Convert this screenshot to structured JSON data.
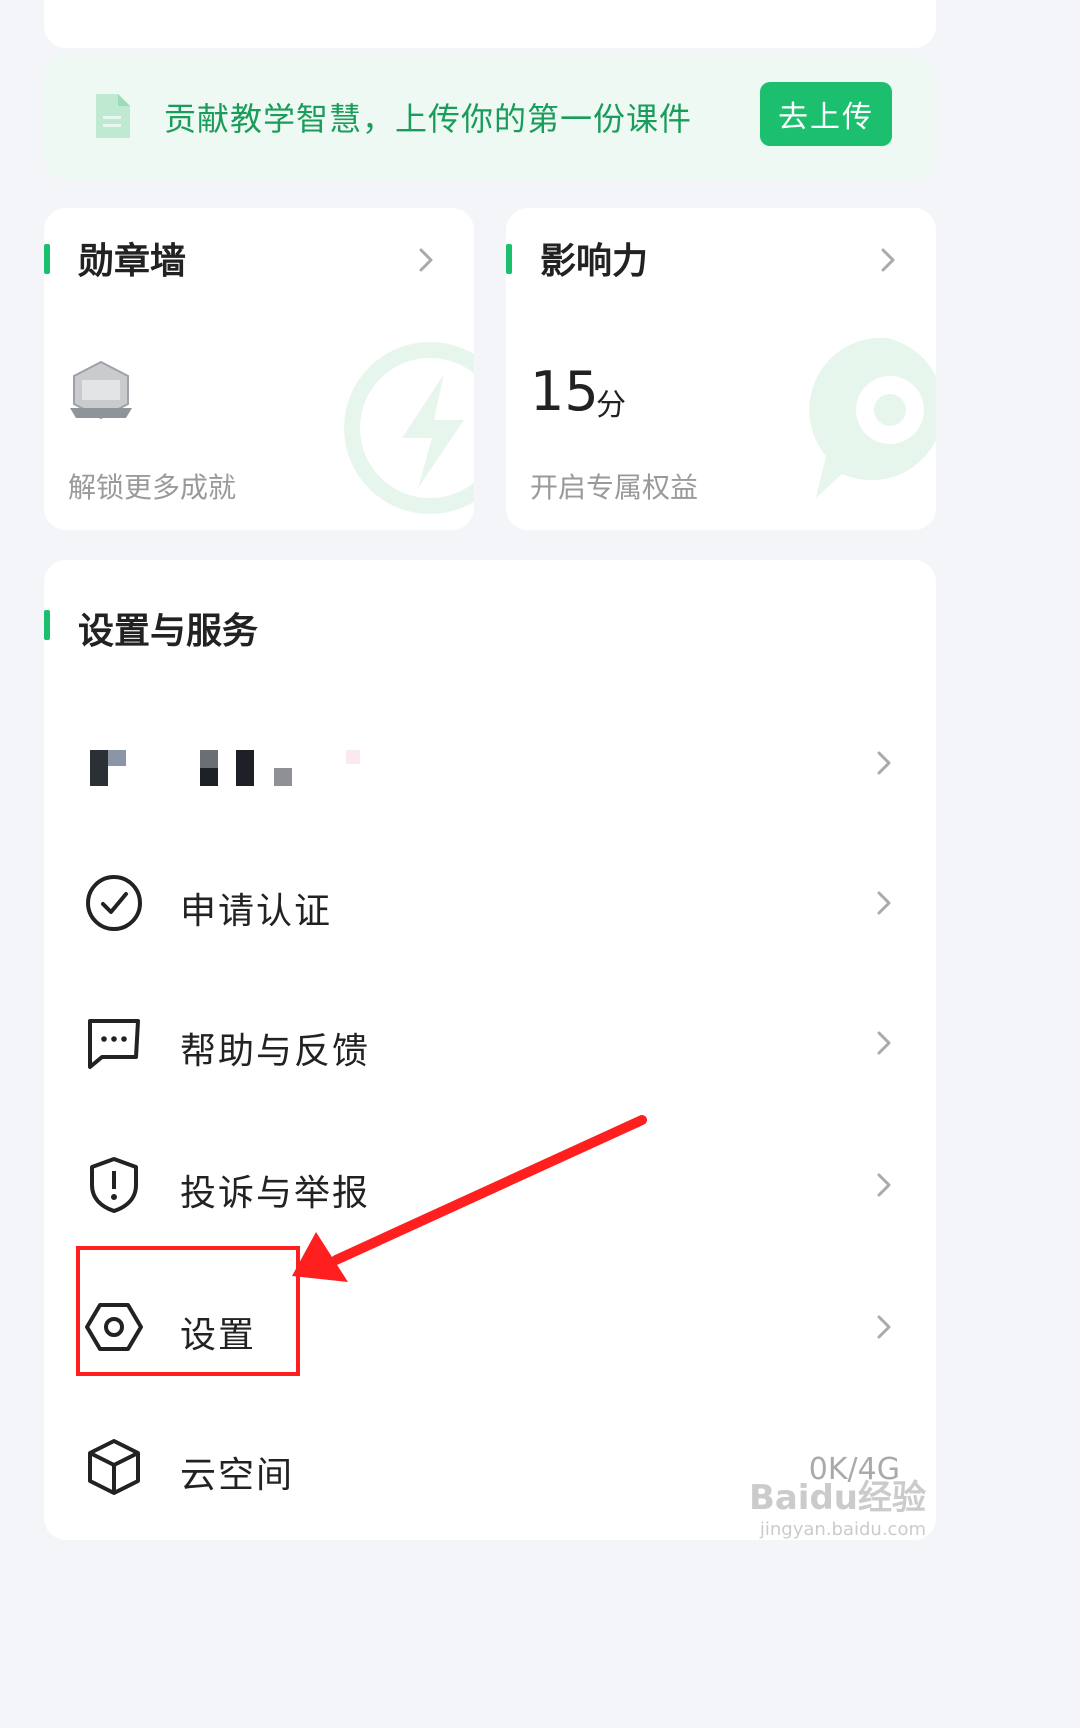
{
  "upload_banner": {
    "text": "贡献教学智慧，上传你的第一份课件",
    "button_label": "去上传"
  },
  "badge_card": {
    "title": "勋章墙",
    "subtitle": "解锁更多成就"
  },
  "influence_card": {
    "title": "影响力",
    "value": "15",
    "unit": "分",
    "subtitle": "开启专属权益"
  },
  "services": {
    "title": "设置与服务",
    "items": [
      {
        "label": "",
        "icon": "pixelated-redacted-icon",
        "extra": ""
      },
      {
        "label": "申请认证",
        "icon": "check-circle-icon",
        "extra": ""
      },
      {
        "label": "帮助与反馈",
        "icon": "chat-bubble-icon",
        "extra": ""
      },
      {
        "label": "投诉与举报",
        "icon": "shield-alert-icon",
        "extra": ""
      },
      {
        "label": "设置",
        "icon": "hexagon-gear-icon",
        "extra": ""
      },
      {
        "label": "云空间",
        "icon": "cube-icon",
        "extra": "0K/4G"
      }
    ]
  },
  "colors": {
    "accent": "#1bbf6e",
    "annotation": "#ff1f1f"
  },
  "watermark": {
    "logo": "Baidu经验",
    "url": "jingyan.baidu.com"
  }
}
